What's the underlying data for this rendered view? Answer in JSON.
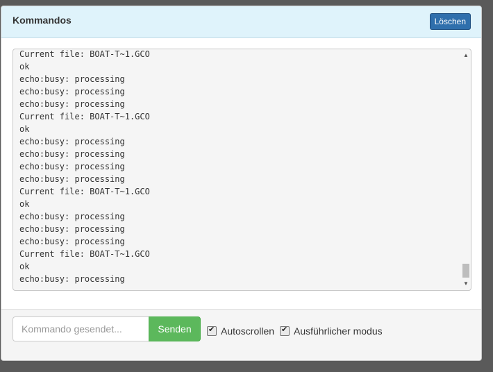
{
  "panel": {
    "title": "Kommandos",
    "clear_label": "Löschen"
  },
  "console": {
    "lines": [
      "Current file: BOAT-T~1.GCO",
      "ok",
      "echo:busy: processing",
      "echo:busy: processing",
      "echo:busy: processing",
      "Current file: BOAT-T~1.GCO",
      "ok",
      "echo:busy: processing",
      "echo:busy: processing",
      "echo:busy: processing",
      "echo:busy: processing",
      "Current file: BOAT-T~1.GCO",
      "ok",
      "echo:busy: processing",
      "echo:busy: processing",
      "echo:busy: processing",
      "Current file: BOAT-T~1.GCO",
      "ok",
      "echo:busy: processing"
    ]
  },
  "footer": {
    "input_placeholder": "Kommando gesendet...",
    "send_label": "Senden",
    "autoscroll_label": "Autoscrollen",
    "autoscroll_checked": true,
    "verbose_label": "Ausführlicher modus",
    "verbose_checked": true
  }
}
